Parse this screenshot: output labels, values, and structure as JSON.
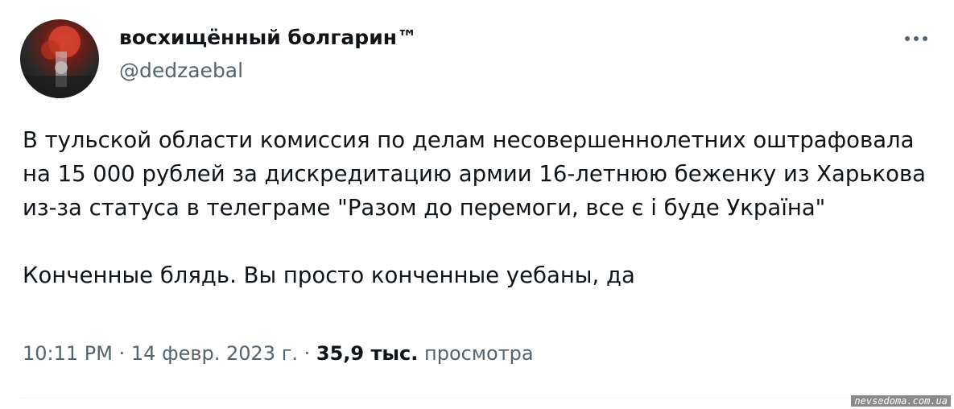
{
  "author": {
    "display_name": "восхищённый болгарин™",
    "handle": "@dedzaebal"
  },
  "icons": {
    "more": "more-horizontal-icon",
    "avatar": "user-avatar"
  },
  "tweet": {
    "paragraph_1": "В тульской области комиссия по делам несовершеннолетних оштрафовала на 15 000 рублей за дискредитацию армии 16-летнюю беженку из Харькова из-за статуса в телеграме \"Разом до перемоги, все є і буде Україна\"",
    "paragraph_2": "Конченные блядь. Вы просто конченные уебаны, да"
  },
  "meta": {
    "time": "10:11 PM",
    "separator": "·",
    "date": "14 февр. 2023 г.",
    "views_count": "35,9 тыс.",
    "views_label": "просмотра"
  },
  "watermark": "nevsedoma.com.ua"
}
